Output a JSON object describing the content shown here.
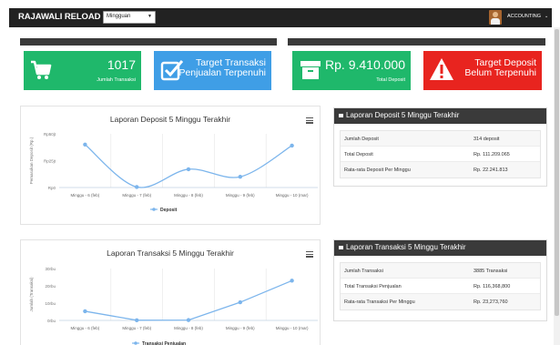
{
  "topbar": {
    "brand": "RAJAWALI RELOAD",
    "period_selected": "Mingguan",
    "user_label": "ACCOUNTING"
  },
  "stats": {
    "transaksi": {
      "value": "1017",
      "label": "Jumlah Transaksi",
      "color": "#1fb86b",
      "icon": "cart-icon"
    },
    "target_transaksi": {
      "label_line1": "Target Transaksi",
      "label_line2": "Penjualan Terpenuhi",
      "color": "#3f9ee6",
      "icon": "checkbox-icon"
    },
    "deposit": {
      "value": "Rp. 9.410.000",
      "label": "Total Deposit",
      "color": "#1fb86b",
      "icon": "archive-box-icon"
    },
    "target_deposit": {
      "label_line1": "Target Deposit",
      "label_line2": "Belum Terpenuhi",
      "color": "#e8241f",
      "icon": "warning-icon"
    }
  },
  "deposit_table": {
    "title": "Laporan Deposit 5 Minggu Terakhir",
    "rows": [
      {
        "key": "Jumlah Deposit",
        "value": "314 deposit"
      },
      {
        "key": "Total Deposit",
        "value": "Rp. 111.209.065"
      },
      {
        "key": "Rata-rata Deposit Per Minggu",
        "value": "Rp. 22.241.813"
      }
    ]
  },
  "transaksi_table": {
    "title": "Laporan Transaksi 5 Minggu Terakhir",
    "rows": [
      {
        "key": "Jumlah Transaksi",
        "value": "3885 Transaksi"
      },
      {
        "key": "Total Transaksi Penjualan",
        "value": "Rp. 116,368,800"
      },
      {
        "key": "Rata-rata Transaksi Per Minggu",
        "value": "Rp. 23,273,760"
      }
    ]
  },
  "chart_data": [
    {
      "type": "line",
      "title": "Laporan Deposit 5 Minggu Terakhir",
      "ylabel": "Pemasukan Deposit (Rp.)",
      "xlabel": "",
      "categories": [
        "Minggu - 6 (feb)",
        "Minggu - 7 (feb)",
        "Minggu - 8 (feb)",
        "Minggu - 9 (feb)",
        "Minggu - 10 (mar)"
      ],
      "y_ticks": [
        "Rp0",
        "Rp25jt",
        "Rp50jt"
      ],
      "ylim": [
        0,
        50
      ],
      "series": [
        {
          "name": "Deposit",
          "values": [
            40,
            0.5,
            17,
            10,
            39
          ],
          "color": "#7cb5ec"
        }
      ],
      "legend_position": "bottom",
      "grid": "vertical"
    },
    {
      "type": "line",
      "title": "Laporan Transaksi 5 Minggu Terakhir",
      "ylabel": "Jumlah (Transaksi)",
      "xlabel": "",
      "categories": [
        "Minggu - 6 (feb)",
        "Minggu - 7 (feb)",
        "Minggu - 8 (feb)",
        "Minggu - 9 (feb)",
        "Minggu - 10 (mar)"
      ],
      "y_ticks": [
        "0rbu",
        "10rbu",
        "20rbu",
        "30rbu"
      ],
      "ylim": [
        0,
        30
      ],
      "series": [
        {
          "name": "Transaksi Penjualan",
          "values": [
            5.3,
            0.1,
            0.2,
            10.5,
            23
          ],
          "color": "#7cb5ec"
        }
      ],
      "legend_position": "bottom",
      "grid": "vertical"
    }
  ]
}
